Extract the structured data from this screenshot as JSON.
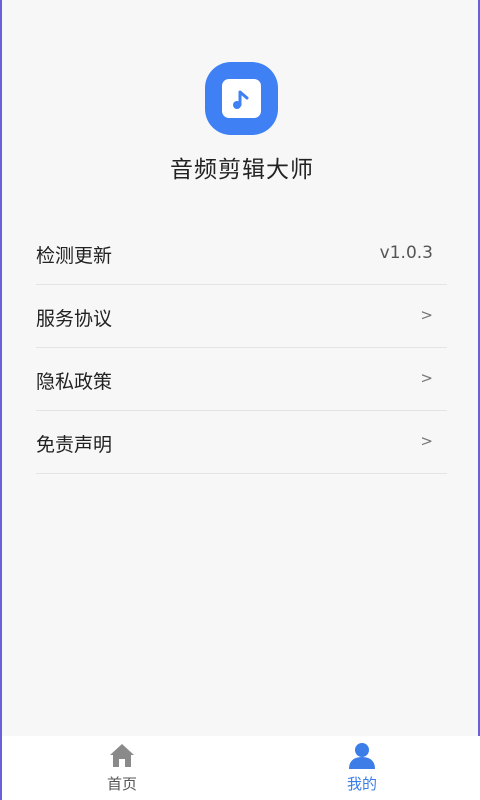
{
  "app": {
    "name": "音频剪辑大师"
  },
  "menu": {
    "items": [
      {
        "label": "检测更新",
        "value": "v1.0.3"
      },
      {
        "label": "服务协议",
        "value": ">"
      },
      {
        "label": "隐私政策",
        "value": ">"
      },
      {
        "label": "免责声明",
        "value": ">"
      }
    ]
  },
  "tabbar": {
    "tabs": [
      {
        "label": "首页",
        "icon": "home-icon",
        "active": false
      },
      {
        "label": "我的",
        "icon": "person-icon",
        "active": true
      }
    ]
  },
  "colors": {
    "accent": "#3c7de8",
    "app_icon_bg": "#3f80f4",
    "frame_border": "#6a5fd6"
  }
}
